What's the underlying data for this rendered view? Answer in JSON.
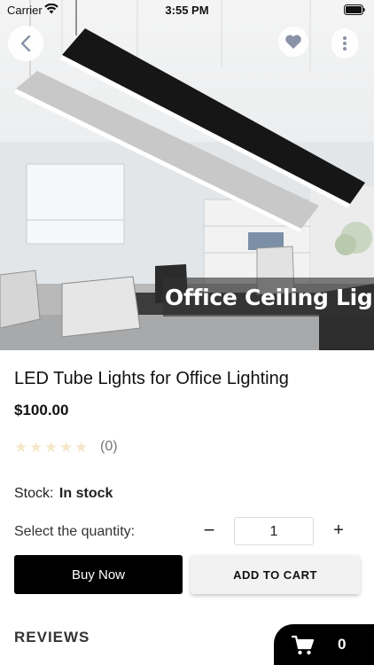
{
  "status_bar": {
    "carrier": "Carrier",
    "time": "3:55 PM"
  },
  "hero": {
    "caption": "Office Ceiling Light"
  },
  "product": {
    "title": "LED Tube Lights for Office Lighting",
    "price": "$100.00",
    "rating": 0,
    "rating_max": 5,
    "rating_count": "(0)",
    "stock_label": "Stock:",
    "stock_value": "In stock"
  },
  "quantity": {
    "label": "Select the quantity:",
    "minus": "−",
    "value": "1",
    "plus": "+"
  },
  "actions": {
    "buy_now": "Buy Now",
    "add_to_cart": "ADD TO CART"
  },
  "reviews": {
    "heading": "REVIEWS"
  },
  "cart": {
    "count": "0"
  },
  "icons": {
    "back": "chevron-left-icon",
    "favorite": "heart-icon",
    "more": "more-vertical-icon",
    "cart": "shopping-cart-icon",
    "star": "star-icon"
  },
  "colors": {
    "primary": "#000000",
    "secondary_button": "#f2f2f2",
    "star_empty": "#f6e7c9",
    "favorite_heart": "#8a93a6"
  }
}
